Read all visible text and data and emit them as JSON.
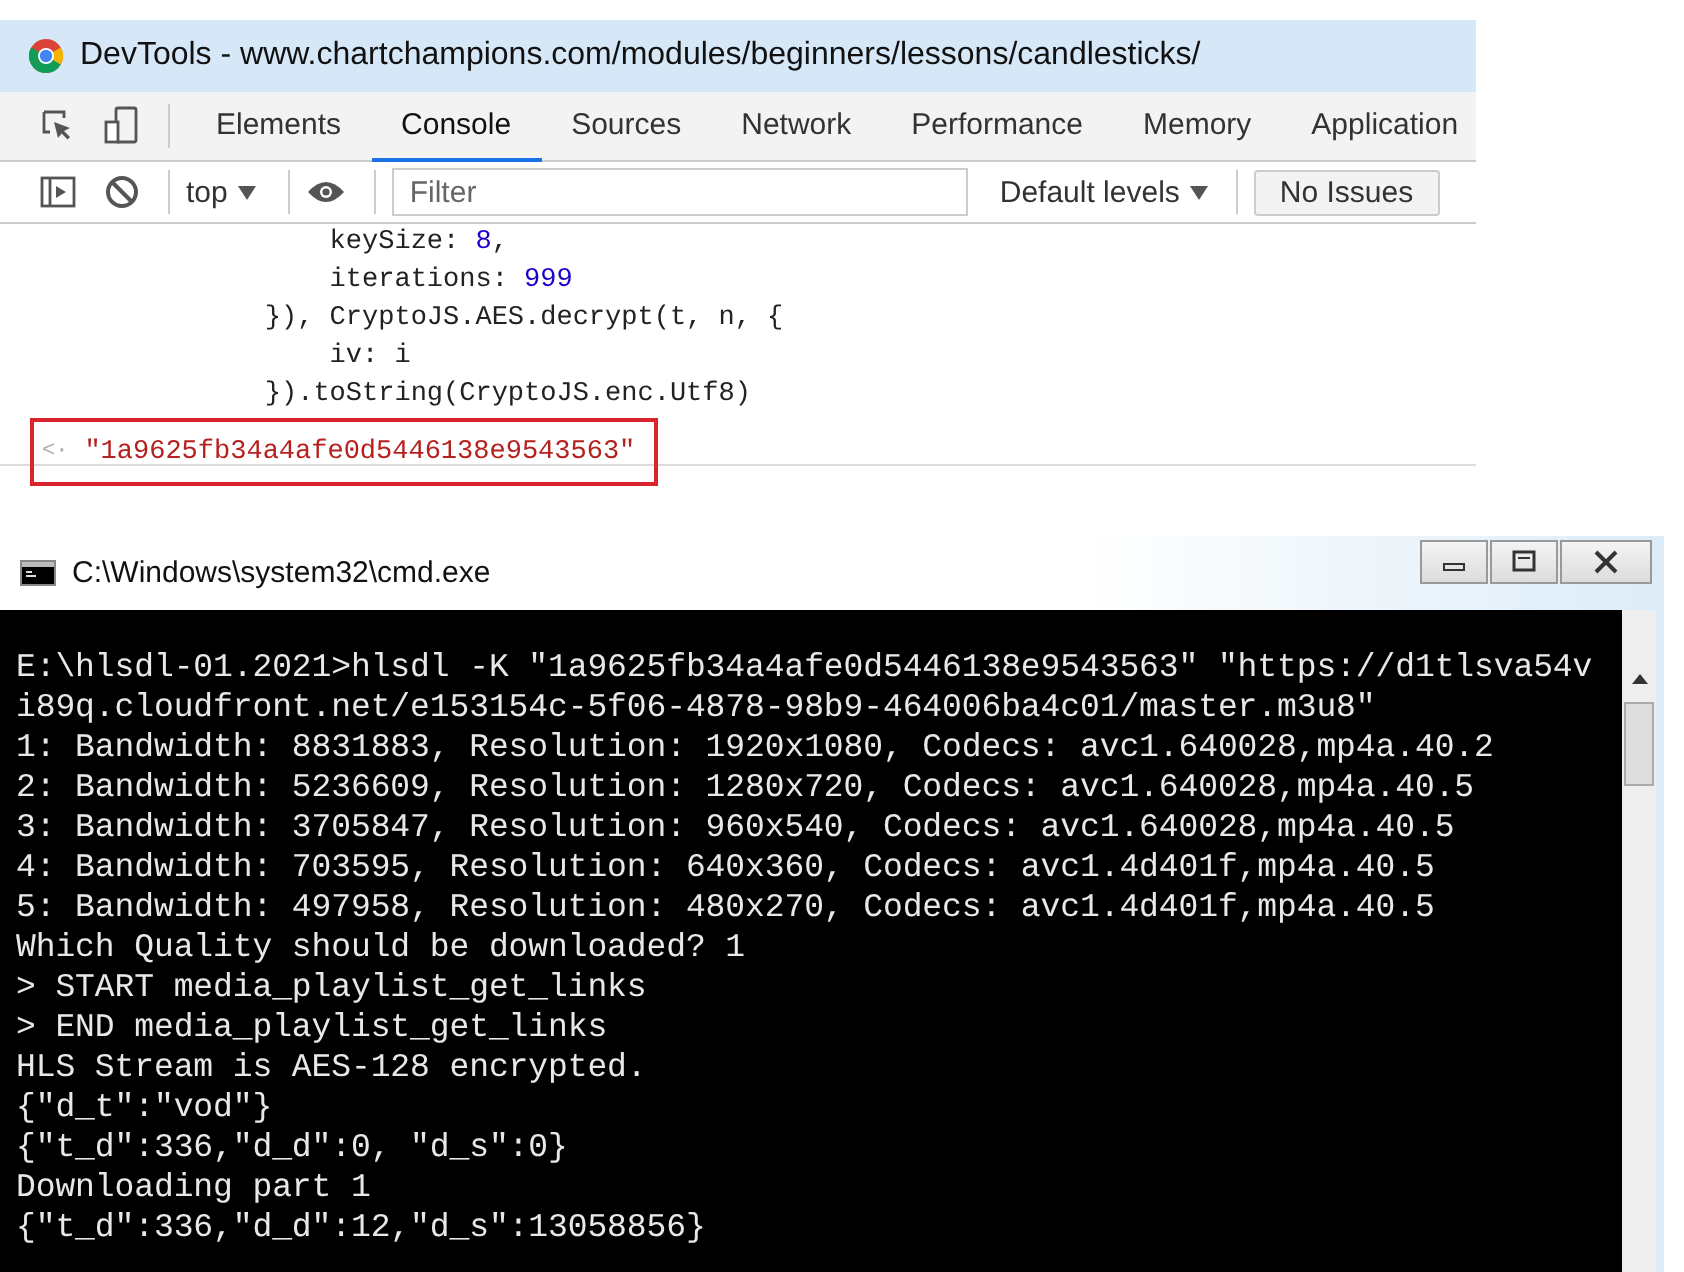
{
  "devtools": {
    "title": "DevTools - www.chartchampions.com/modules/beginners/lessons/candlesticks/",
    "tabs": [
      {
        "label": "Elements",
        "selected": false
      },
      {
        "label": "Console",
        "selected": true
      },
      {
        "label": "Sources",
        "selected": false
      },
      {
        "label": "Network",
        "selected": false
      },
      {
        "label": "Performance",
        "selected": false
      },
      {
        "label": "Memory",
        "selected": false
      },
      {
        "label": "Application",
        "selected": false
      }
    ],
    "toolbar": {
      "context": "top",
      "filter": {
        "placeholder": "Filter"
      },
      "levels": "Default levels",
      "issues": "No Issues"
    },
    "code_lines": [
      [
        {
          "text": "        keySize: ",
          "kind": "plain"
        },
        {
          "text": "8",
          "kind": "number"
        },
        {
          "text": ",",
          "kind": "plain"
        }
      ],
      [
        {
          "text": "        iterations: ",
          "kind": "plain"
        },
        {
          "text": "999",
          "kind": "number"
        }
      ],
      [
        {
          "text": "    }), CryptoJS.AES.decrypt(t, n, {",
          "kind": "plain"
        }
      ],
      [
        {
          "text": "        iv: i",
          "kind": "plain"
        }
      ],
      [
        {
          "text": "    }).toString(CryptoJS.enc.Utf8)",
          "kind": "plain"
        }
      ]
    ],
    "result": {
      "prompt": "<·",
      "value": "\"1a9625fb34a4afe0d5446138e9543563\"",
      "highlighted": true
    }
  },
  "cmd": {
    "title": "C:\\Windows\\system32\\cmd.exe",
    "lines": [
      "E:\\hlsdl-01.2021>hlsdl -K \"1a9625fb34a4afe0d5446138e9543563\" \"https://d1tlsva54v",
      "i89q.cloudfront.net/e153154c-5f06-4878-98b9-464006ba4c01/master.m3u8\"",
      "1: Bandwidth: 8831883, Resolution: 1920x1080, Codecs: avc1.640028,mp4a.40.2",
      "2: Bandwidth: 5236609, Resolution: 1280x720, Codecs: avc1.640028,mp4a.40.5",
      "3: Bandwidth: 3705847, Resolution: 960x540, Codecs: avc1.640028,mp4a.40.5",
      "4: Bandwidth: 703595, Resolution: 640x360, Codecs: avc1.4d401f,mp4a.40.5",
      "5: Bandwidth: 497958, Resolution: 480x270, Codecs: avc1.4d401f,mp4a.40.5",
      "Which Quality should be downloaded? 1",
      "> START media_playlist_get_links",
      "> END media_playlist_get_links",
      "HLS Stream is AES-128 encrypted.",
      "{\"d_t\":\"vod\"}",
      "{\"t_d\":336,\"d_d\":0, \"d_s\":0}",
      "Downloading part 1",
      "{\"t_d\":336,\"d_d\":12,\"d_s\":13058856}"
    ]
  }
}
